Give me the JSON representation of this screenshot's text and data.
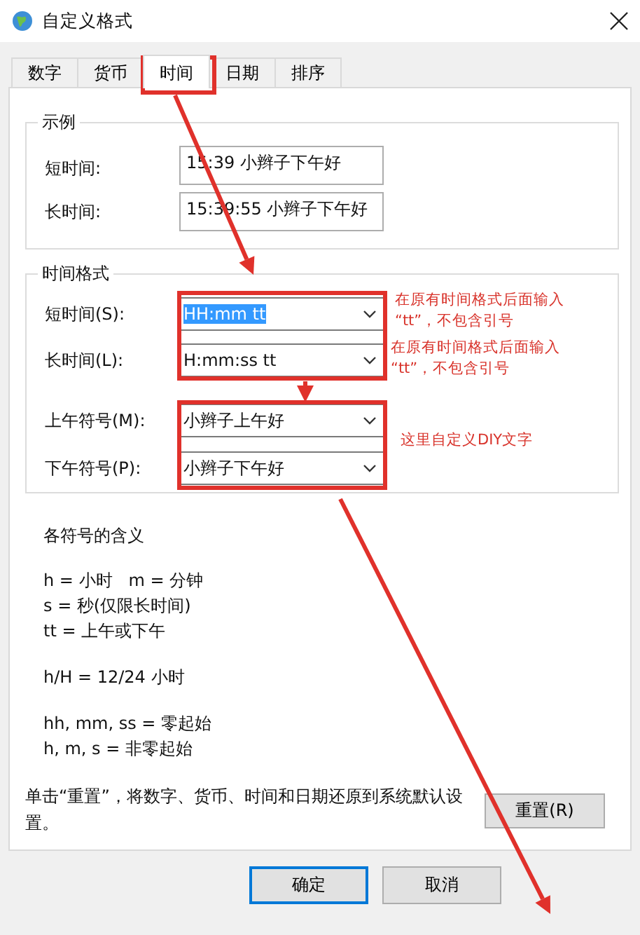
{
  "window": {
    "title": "自定义格式"
  },
  "tabs": [
    {
      "label": "数字",
      "selected": false
    },
    {
      "label": "货币",
      "selected": false
    },
    {
      "label": "时间",
      "selected": true
    },
    {
      "label": "日期",
      "selected": false
    },
    {
      "label": "排序",
      "selected": false
    }
  ],
  "example": {
    "title": "示例",
    "fields": [
      {
        "label": "短时间:",
        "value": "15:39 小辫子下午好"
      },
      {
        "label": "长时间:",
        "value": "15:39:55 小辫子下午好"
      }
    ]
  },
  "time_format": {
    "title": "时间格式",
    "fields": [
      {
        "label": "短时间(S):",
        "value": "HH:mm tt",
        "highlighted": true
      },
      {
        "label": "长时间(L):",
        "value": "H:mm:ss tt",
        "highlighted": false
      },
      {
        "label": "上午符号(M):",
        "value": "小辫子上午好",
        "highlighted": false
      },
      {
        "label": "下午符号(P):",
        "value": "小辫子下午好",
        "highlighted": false
      }
    ]
  },
  "legend": {
    "title": "各符号的含义",
    "groups": [
      {
        "lines": [
          "h = 小时   m = 分钟",
          "s = 秒(仅限长时间)",
          "tt = 上午或下午"
        ]
      },
      {
        "lines": [
          "h/H = 12/24 小时"
        ]
      },
      {
        "lines": [
          "hh, mm, ss = 零起始",
          "h, m, s = 非零起始"
        ]
      }
    ]
  },
  "reset": {
    "note": "单击“重置”，将数字、货币、时间和日期还原到系统默认设置。",
    "button": "重置(R)"
  },
  "buttons": [
    {
      "label": "确定",
      "default": true
    },
    {
      "label": "取消",
      "default": false
    }
  ],
  "annotations": [
    {
      "lines": [
        "在原有时间格式后面输入",
        "“tt”，不包含引号"
      ]
    },
    {
      "lines": [
        "在原有时间格式后面输入",
        "“tt”，不包含引号"
      ]
    },
    {
      "lines": [
        "这里自定义DIY文字"
      ]
    }
  ]
}
